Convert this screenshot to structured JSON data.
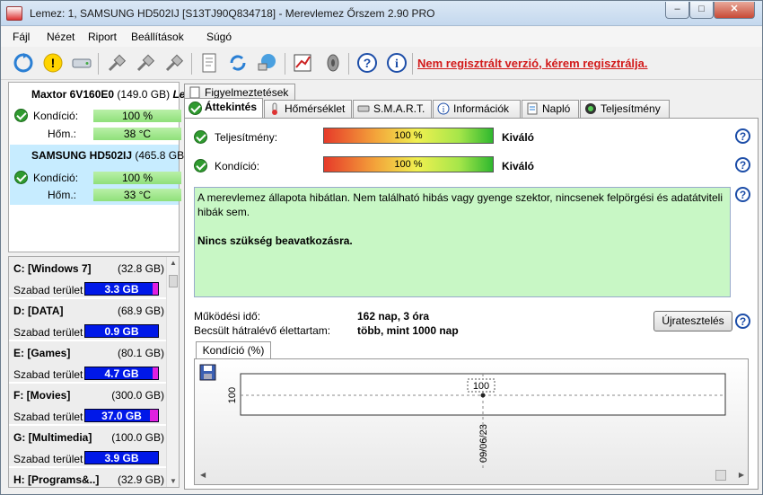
{
  "window": {
    "title": "Lemez: 1, SAMSUNG HD502IJ [S13TJ90Q834718]  -  Merevlemez Őrszem 2.90 PRO",
    "buttons": {
      "minimize": "–",
      "maximize": "□",
      "close": "✕"
    }
  },
  "menu": [
    {
      "label": "Fájl"
    },
    {
      "label": "Nézet"
    },
    {
      "label": "Riport"
    },
    {
      "label": "Beállítások"
    },
    {
      "label": "Súgó"
    }
  ],
  "toolbar": {
    "icons": [
      "refresh-icon",
      "warning-icon",
      "drive-icon",
      "usb-plug-icon",
      "usb-plug-icon",
      "usb-plug-icon",
      "document-icon",
      "sync-icon",
      "network-icon",
      "chart-edit-icon",
      "speaker-icon",
      "help-icon",
      "info-icon"
    ],
    "register_link": "Nem regisztrált verzió, kérem regisztrálja."
  },
  "disks": [
    {
      "name": "Maxtor 6V160E0",
      "size": "(149.0 GB)",
      "suffix": "Le",
      "condition_label": "Kondíció:",
      "condition": "100 %",
      "temp_label": "Hőm.:",
      "temp": "38 °C"
    },
    {
      "name": "SAMSUNG HD502IJ",
      "size": "(465.8 GB)",
      "suffix": "",
      "condition_label": "Kondíció:",
      "condition": "100 %",
      "temp_label": "Hőm.:",
      "temp": "33 °C"
    }
  ],
  "volumes": [
    {
      "name": "C: [Windows 7]",
      "size": "(32.8 GB)",
      "free_label": "Szabad terület",
      "free": "3.3 GB"
    },
    {
      "name": "D: [DATA]",
      "size": "(68.9 GB)",
      "free_label": "Szabad terület",
      "free": "0.9 GB"
    },
    {
      "name": "E: [Games]",
      "size": "(80.1 GB)",
      "free_label": "Szabad terület",
      "free": "4.7 GB"
    },
    {
      "name": "F: [Movies]",
      "size": "(300.0 GB)",
      "free_label": "Szabad terület",
      "free": "37.0 GB"
    },
    {
      "name": "G: [Multimedia]",
      "size": "(100.0 GB)",
      "free_label": "Szabad terület",
      "free": "3.9 GB"
    },
    {
      "name": "H: [Programs&..]",
      "size": "(32.9 GB)",
      "free_label": "",
      "free": ""
    }
  ],
  "tabs_row1": [
    {
      "label": "Figyelmeztetések"
    }
  ],
  "tabs_row2": [
    {
      "label": "Áttekintés"
    },
    {
      "label": "Hőmérséklet"
    },
    {
      "label": "S.M.A.R.T."
    },
    {
      "label": "Információk"
    },
    {
      "label": "Napló"
    },
    {
      "label": "Teljesítmény"
    }
  ],
  "overview": {
    "performance_label": "Teljesítmény:",
    "performance_value": "100 %",
    "performance_rating": "Kiváló",
    "condition_label": "Kondíció:",
    "condition_value": "100 %",
    "condition_rating": "Kiváló",
    "message_line1": "A merevlemez állapota hibátlan. Nem található hibás vagy gyenge szektor, nincsenek felpörgési és adatátviteli hibák sem.",
    "message_line2": "Nincs szükség beavatkozásra.",
    "uptime_label": "Működési idő:",
    "uptime_value": "162 nap, 3 óra",
    "lifetime_label": "Becsült hátralévő élettartam:",
    "lifetime_value": "több, mint 1000 nap",
    "retest_button": "Újratesztelés",
    "chart_tab": "Kondíció  (%)"
  },
  "chart_data": {
    "type": "line",
    "x": [
      "09/06/23"
    ],
    "series": [
      {
        "values": [
          100
        ]
      }
    ],
    "ylabel": "100",
    "point_label": "100"
  }
}
